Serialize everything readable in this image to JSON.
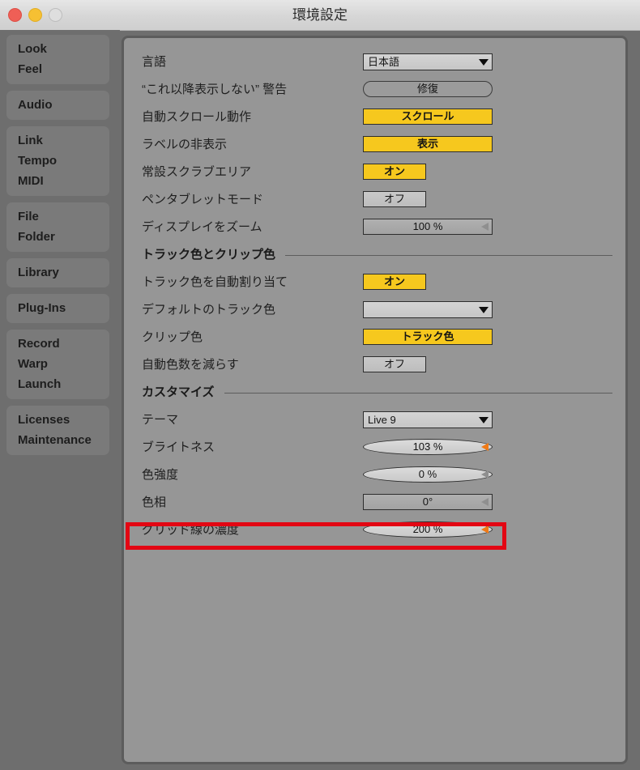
{
  "window": {
    "title": "環境設定",
    "traffic_lights": [
      "close-red",
      "minimize-yellow",
      "zoom-disabled"
    ]
  },
  "sidebar": {
    "groups": [
      {
        "items": [
          "Look",
          "Feel"
        ]
      },
      {
        "items": [
          "Audio"
        ]
      },
      {
        "items": [
          "Link",
          "Tempo",
          "MIDI"
        ]
      },
      {
        "items": [
          "File",
          "Folder"
        ]
      },
      {
        "items": [
          "Library"
        ]
      },
      {
        "items": [
          "Plug-Ins"
        ]
      },
      {
        "items": [
          "Record",
          "Warp",
          "Launch"
        ]
      },
      {
        "items": [
          "Licenses",
          "Maintenance"
        ]
      }
    ]
  },
  "main": {
    "rows": [
      {
        "label": "言語",
        "type": "dropdown",
        "value": "日本語"
      },
      {
        "label": "“これ以降表示しない” 警告",
        "type": "pill",
        "value": "修復"
      },
      {
        "label": "自動スクロール動作",
        "type": "toggle-on",
        "value": "スクロール"
      },
      {
        "label": "ラベルの非表示",
        "type": "toggle-on",
        "value": "表示"
      },
      {
        "label": "常設スクラブエリア",
        "type": "toggle-on-narrow",
        "value": "オン"
      },
      {
        "label": "ペンタブレットモード",
        "type": "toggle-off-narrow",
        "value": "オフ"
      },
      {
        "label": "ディスプレイをズーム",
        "type": "slider-gray",
        "value": "100 %"
      }
    ],
    "section_track": {
      "title": "トラック色とクリップ色",
      "rows": [
        {
          "label": "トラック色を自動割り当て",
          "type": "toggle-on-narrow",
          "value": "オン"
        },
        {
          "label": "デフォルトのトラック色",
          "type": "dropdown",
          "value": ""
        },
        {
          "label": "クリップ色",
          "type": "toggle-on",
          "value": "トラック色"
        },
        {
          "label": "自動色数を減らす",
          "type": "toggle-off-narrow",
          "value": "オフ"
        }
      ]
    },
    "section_customize": {
      "title": "カスタマイズ",
      "rows": [
        {
          "label": "テーマ",
          "type": "dropdown",
          "value": "Live 9"
        },
        {
          "label": "ブライトネス",
          "type": "slider-orange",
          "value": "103 %"
        },
        {
          "label": "色強度",
          "type": "slider-gray-light",
          "value": "0 %"
        },
        {
          "label": "色相",
          "type": "slider-gray",
          "value": "0°"
        },
        {
          "label": "グリッド線の濃度",
          "type": "slider-orange",
          "value": "200 %",
          "highlighted": true
        }
      ]
    }
  },
  "colors": {
    "accent_yellow": "#f6c81e",
    "slider_handle_active": "#f07a16",
    "slider_handle_inactive": "#8f8f8f",
    "highlight_box": "#e30613",
    "panel_bg": "#969696",
    "sidebar_bg": "#6e6e6e"
  }
}
